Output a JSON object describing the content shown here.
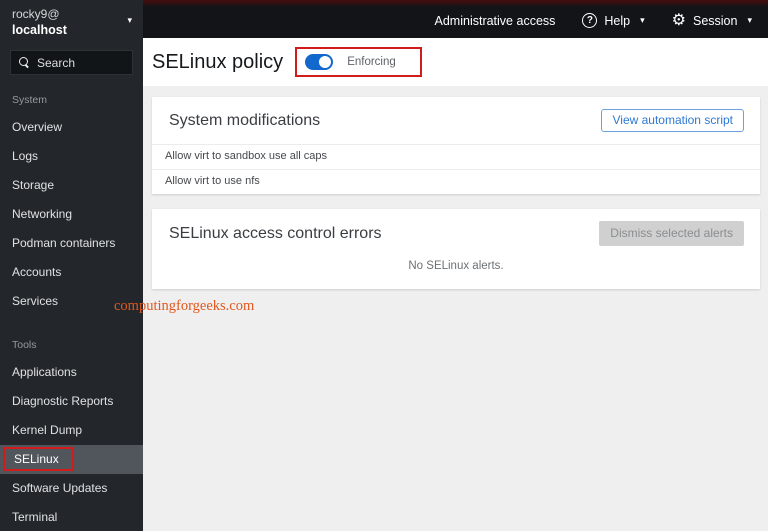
{
  "topbar": {
    "admin_access": "Administrative access",
    "help": "Help",
    "help_icon_glyph": "?",
    "session": "Session",
    "caret": "▾"
  },
  "sidebar": {
    "host_user": "rocky9@",
    "host_name": "localhost",
    "host_caret": "▾",
    "search_placeholder": "Search",
    "sections": [
      {
        "label": "System",
        "items": [
          {
            "label": "Overview"
          },
          {
            "label": "Logs"
          },
          {
            "label": "Storage"
          },
          {
            "label": "Networking"
          },
          {
            "label": "Podman containers"
          },
          {
            "label": "Accounts"
          },
          {
            "label": "Services"
          }
        ]
      },
      {
        "label": "Tools",
        "items": [
          {
            "label": "Applications"
          },
          {
            "label": "Diagnostic Reports"
          },
          {
            "label": "Kernel Dump"
          },
          {
            "label": "SELinux",
            "selected": true
          },
          {
            "label": "Software Updates"
          },
          {
            "label": "Terminal"
          }
        ]
      }
    ]
  },
  "main": {
    "title": "SELinux policy",
    "toggle": {
      "label": "Enforcing",
      "state": "on"
    },
    "modifications_card": {
      "title": "System modifications",
      "button": "View automation script",
      "rows": [
        "Allow virt to sandbox use all caps",
        "Allow virt to use nfs"
      ]
    },
    "errors_card": {
      "title": "SELinux access control errors",
      "button": "Dismiss selected alerts",
      "empty": "No SELinux alerts."
    }
  },
  "watermark": "computingforgeeks.com",
  "colors": {
    "accent_blue": "#2d79d4",
    "toggle_blue": "#1268cc",
    "annotation_red": "#d21c1c",
    "masthead_red": "#460d0d",
    "sidebar_bg": "#23272b",
    "topbar_bg": "#121417",
    "selected_item_bg": "#51565c",
    "page_bg": "#efefef",
    "watermark_orange": "#e2571e"
  }
}
